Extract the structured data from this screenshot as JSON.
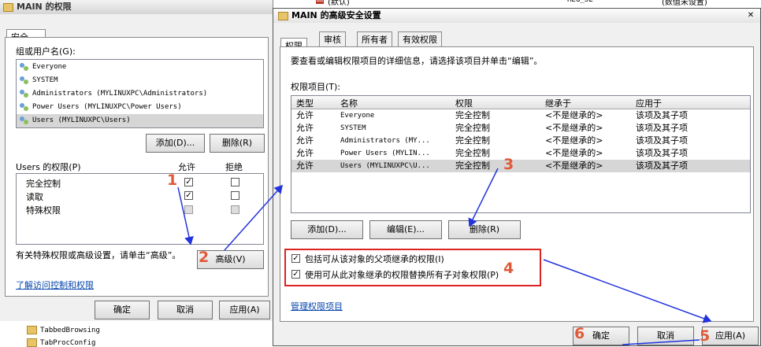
{
  "left_window": {
    "title": "MAIN 的权限",
    "tab": "安全",
    "group_label": "组或用户名(G):",
    "users": [
      "Everyone",
      "SYSTEM",
      "Administrators (MYLINUXPC\\Administrators)",
      "Power Users (MYLINUXPC\\Power Users)",
      "Users (MYLINUXPC\\Users)"
    ],
    "add_label": "添加(D)...",
    "remove_label": "删除(R)",
    "perm_header": "Users 的权限(P)",
    "allow_header": "允许",
    "deny_header": "拒绝",
    "permissions": [
      {
        "name": "完全控制",
        "allow": "✓",
        "deny": ""
      },
      {
        "name": "读取",
        "allow": "✓",
        "deny": ""
      },
      {
        "name": "特殊权限",
        "allow": "",
        "deny": ""
      }
    ],
    "special_text": "有关特殊权限或高级设置，请单击“高级”。",
    "advanced_label": "高级(V)",
    "link": "了解访问控制和权限",
    "ok_label": "确定",
    "cancel_label": "取消",
    "apply_label": "应用(A)"
  },
  "background": {
    "row_icon_text": "ab",
    "row_name": "(默认)",
    "row_type": "REG_SZ",
    "row_data": "(数值未设置)",
    "tree_items": [
      "TabbedBrowsing",
      "TabProcConfig"
    ]
  },
  "adv_window": {
    "title": "MAIN 的高级安全设置",
    "close_glyph": "✕",
    "tabs": [
      "权限",
      "审核",
      "所有者",
      "有效权限"
    ],
    "desc": "要查看或编辑权限项目的详细信息，请选择该项目并单击“编辑”。",
    "entries_label": "权限项目(T):",
    "columns": [
      "类型",
      "名称",
      "权限",
      "继承于",
      "应用于"
    ],
    "entries": [
      {
        "type": "允许",
        "name": "Everyone",
        "perm": "完全控制",
        "inherit": "<不是继承的>",
        "apply": "该项及其子项"
      },
      {
        "type": "允许",
        "name": "SYSTEM",
        "perm": "完全控制",
        "inherit": "<不是继承的>",
        "apply": "该项及其子项"
      },
      {
        "type": "允许",
        "name": "Administrators (MY...",
        "perm": "完全控制",
        "inherit": "<不是继承的>",
        "apply": "该项及其子项"
      },
      {
        "type": "允许",
        "name": "Power Users (MYLIN...",
        "perm": "完全控制",
        "inherit": "<不是继承的>",
        "apply": "该项及其子项"
      },
      {
        "type": "允许",
        "name": "Users (MYLINUXPC\\U...",
        "perm": "完全控制",
        "inherit": "<不是继承的>",
        "apply": "该项及其子项"
      }
    ],
    "add_label": "添加(D)...",
    "edit_label": "编辑(E)...",
    "remove_label": "删除(R)",
    "check1_label": "包括可从该对象的父项继承的权限(I)",
    "check2_label": "使用可从此对象继承的权限替换所有子对象权限(P)",
    "check1": "✓",
    "check2": "✓",
    "manage_link": "管理权限项目",
    "ok_label": "确定",
    "cancel_label": "取消",
    "apply_label": "应用(A)"
  },
  "annotations": [
    "1",
    "2",
    "3",
    "4",
    "5",
    "6"
  ],
  "colors": {
    "arrow": "#2233dd",
    "highlight": "#dd2222",
    "number": "#e05a3a",
    "selection": "#d6d6d6",
    "link": "#0645ad"
  }
}
